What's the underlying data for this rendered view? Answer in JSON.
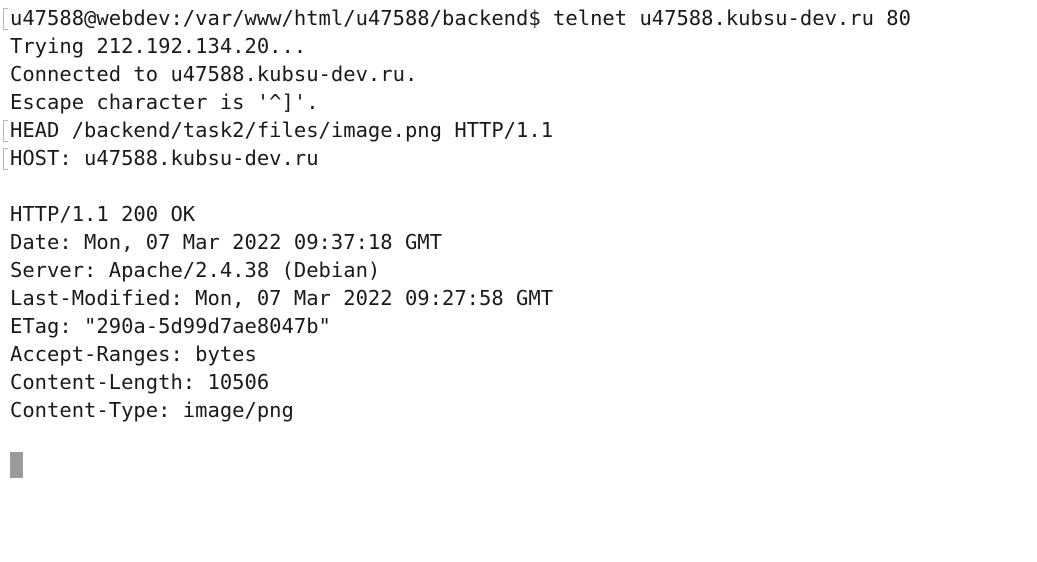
{
  "terminal": {
    "lines": [
      "u47588@webdev:/var/www/html/u47588/backend$ telnet u47588.kubsu-dev.ru 80",
      "Trying 212.192.134.20...",
      "Connected to u47588.kubsu-dev.ru.",
      "Escape character is '^]'.",
      "HEAD /backend/task2/files/image.png HTTP/1.1",
      "HOST: u47588.kubsu-dev.ru",
      "",
      "HTTP/1.1 200 OK",
      "Date: Mon, 07 Mar 2022 09:37:18 GMT",
      "Server: Apache/2.4.38 (Debian)",
      "Last-Modified: Mon, 07 Mar 2022 09:27:58 GMT",
      "ETag: \"290a-5d99d7ae8047b\"",
      "Accept-Ranges: bytes",
      "Content-Length: 10506",
      "Content-Type: image/png"
    ]
  }
}
